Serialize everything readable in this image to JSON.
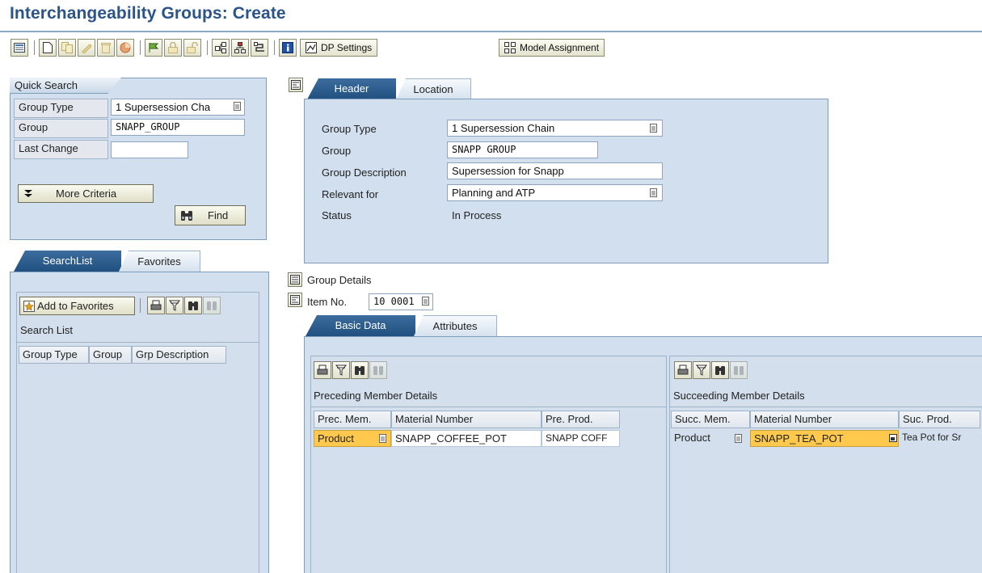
{
  "title": "Interchangeability Groups: Create",
  "toolbar": {
    "dp_settings": "DP Settings",
    "model_assignment": "Model Assignment",
    "icons": [
      "overview-icon",
      "new-document-icon",
      "copy-icon",
      "edit-icon",
      "delete-icon",
      "cancel-icon",
      "check-icon",
      "lock-icon",
      "unlock-icon",
      "graphic-icon",
      "hierarchy-icon",
      "network-icon",
      "info-icon",
      "settings-icon",
      "model-icon"
    ]
  },
  "quick_search": {
    "title": "Quick Search",
    "group_type_label": "Group Type",
    "group_type_value": "1 Supersession Cha",
    "group_label": "Group",
    "group_value": "SNAPP_GROUP",
    "last_change_label": "Last Change",
    "last_change_value": "",
    "more_criteria": "More Criteria",
    "find": "Find"
  },
  "left_tabs": {
    "searchlist": "SearchList",
    "favorites": "Favorites"
  },
  "search_list": {
    "add_to_favorites": "Add to Favorites",
    "title": "Search List",
    "columns": [
      "Group Type",
      "Group",
      "Grp Description"
    ]
  },
  "header_tabs": {
    "header": "Header",
    "location": "Location"
  },
  "header": {
    "group_type_label": "Group Type",
    "group_type_value": "1 Supersession Chain",
    "group_label": "Group",
    "group_value": "SNAPP GROUP",
    "description_label": "Group Description",
    "description_value": "Supersession for Snapp",
    "relevant_label": "Relevant for",
    "relevant_value": "Planning and ATP",
    "status_label": "Status",
    "status_value": "In Process"
  },
  "group_details": {
    "label": "Group Details",
    "item_no_label": "Item No.",
    "item_no_value": "10 0001"
  },
  "detail_tabs": {
    "basic_data": "Basic Data",
    "attributes": "Attributes"
  },
  "preceding": {
    "title": "Preceding Member Details",
    "columns": [
      "Prec. Mem.",
      "Material Number",
      "Pre. Prod."
    ],
    "rows": [
      {
        "member": "Product",
        "material": "SNAPP_COFFEE_POT",
        "prod": "SNAPP COFF"
      }
    ]
  },
  "succeeding": {
    "title": "Succeeding Member Details",
    "columns": [
      "Succ. Mem.",
      "Material Number",
      "Suc. Prod."
    ],
    "rows": [
      {
        "member": "Product",
        "material": "SNAPP_TEA_POT",
        "prod": "Tea Pot for Sr"
      }
    ]
  },
  "colors": {
    "title": "#2b5488",
    "panel": "#d1dfee",
    "active_tab": "#2f5f8f",
    "highlight": "#ffc94d"
  }
}
